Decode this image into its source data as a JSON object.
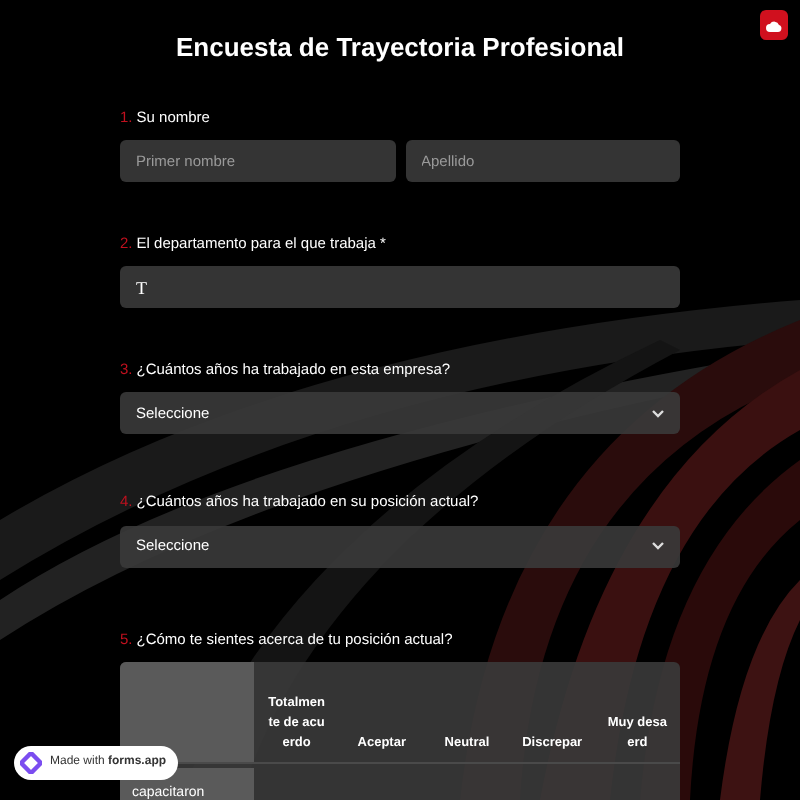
{
  "title": "Encuesta de Trayectoria Profesional",
  "questions": [
    {
      "kind": "name",
      "number": "1.",
      "label": "Su nombre",
      "fields": [
        {
          "placeholder": "Primer nombre"
        },
        {
          "placeholder": "Apellido"
        }
      ]
    },
    {
      "kind": "text",
      "number": "2.",
      "label": "El departamento para el que trabaja *",
      "value": "T"
    },
    {
      "kind": "select",
      "number": "3.",
      "label": "¿Cuántos años ha trabajado en esta empresa?",
      "value": "Seleccione"
    },
    {
      "kind": "select",
      "number": "4.",
      "label": "¿Cuántos años ha trabajado en su posición actual?",
      "value": "Seleccione"
    },
    {
      "kind": "matrix",
      "number": "5.",
      "label": "¿Cómo te sientes acerca de tu posición actual?",
      "columns": [
        "Totalmente de acuerdo",
        "Aceptar",
        "Neutral",
        "Discrepar",
        "Muy desa erd"
      ],
      "rows": [
        "capacitaron"
      ]
    }
  ],
  "badge": {
    "prefix": "Made with",
    "brand": "forms.app"
  }
}
